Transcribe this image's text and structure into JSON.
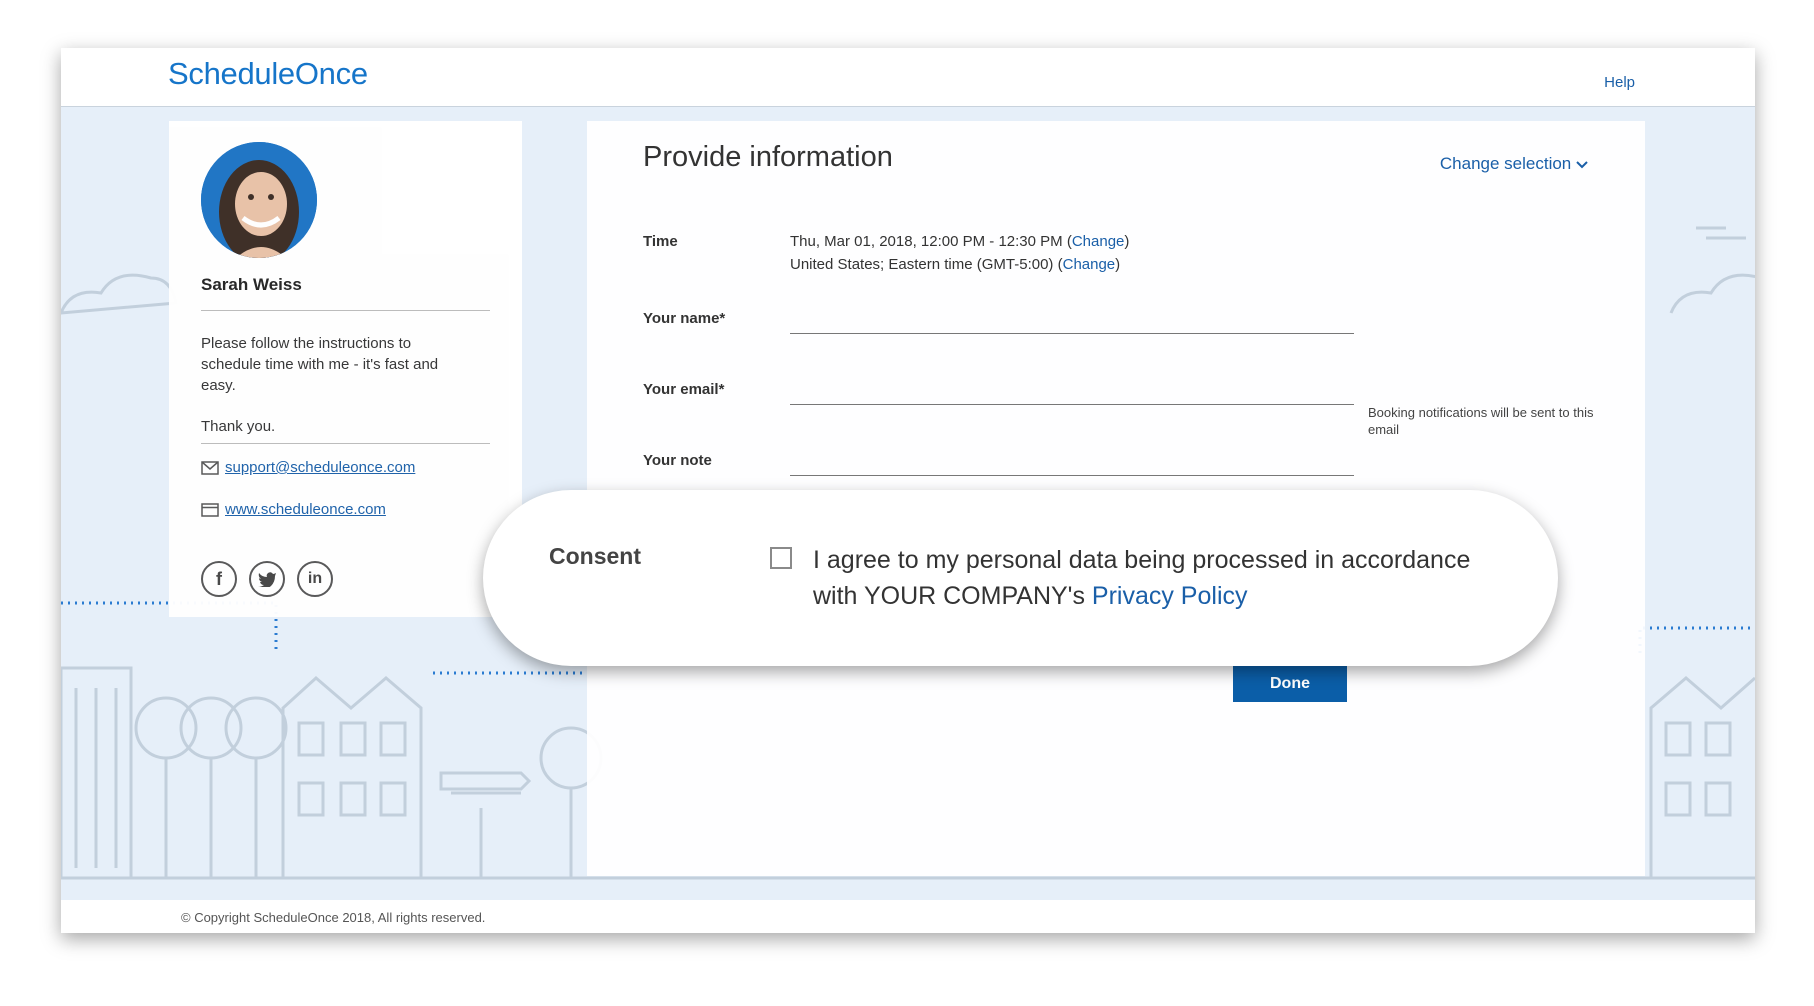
{
  "header": {
    "logo": "ScheduleOnce",
    "help": "Help"
  },
  "profile": {
    "name": "Sarah Weiss",
    "description": "Please follow the instructions to schedule time with me - it's fast and easy.",
    "thanks": "Thank you.",
    "email": "support@scheduleonce.com",
    "website": "www.scheduleonce.com",
    "social": [
      "facebook-icon",
      "twitter-icon",
      "linkedin-icon"
    ]
  },
  "form": {
    "title": "Provide information",
    "change_selection": "Change selection",
    "time_label": "Time",
    "time_value": "Thu, Mar 01, 2018, 12:00 PM - 12:30 PM",
    "timezone_value": "United States; Eastern time (GMT-5:00)",
    "change_link": "Change",
    "name_label": "Your name*",
    "email_label": "Your email*",
    "email_hint": "Booking notifications will be sent to this email",
    "note_label": "Your note",
    "done": "Done"
  },
  "consent": {
    "label": "Consent",
    "text": "I agree to my personal data being processed in accordance with YOUR COMPANY's",
    "link": "Privacy Policy"
  },
  "footer": {
    "copyright": "© Copyright ScheduleOnce 2018, All rights reserved."
  },
  "colors": {
    "brand": "#1675c9",
    "link": "#1a5fa8",
    "button": "#0b5ea8",
    "background": "#e6eff9"
  }
}
